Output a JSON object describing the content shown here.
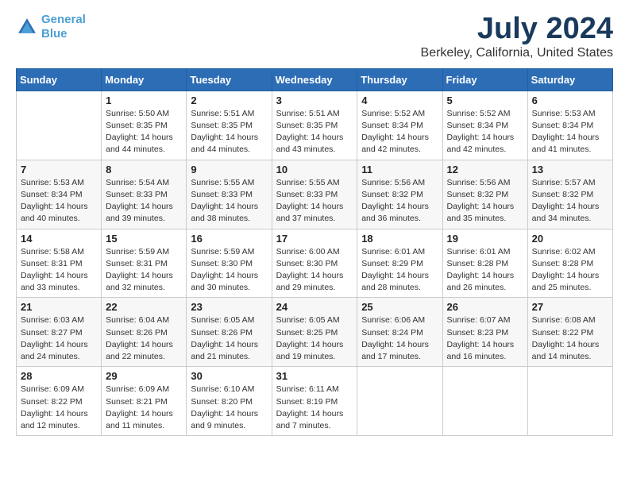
{
  "header": {
    "logo_line1": "General",
    "logo_line2": "Blue",
    "month": "July 2024",
    "location": "Berkeley, California, United States"
  },
  "weekdays": [
    "Sunday",
    "Monday",
    "Tuesday",
    "Wednesday",
    "Thursday",
    "Friday",
    "Saturday"
  ],
  "weeks": [
    [
      {
        "num": "",
        "info": ""
      },
      {
        "num": "1",
        "info": "Sunrise: 5:50 AM\nSunset: 8:35 PM\nDaylight: 14 hours\nand 44 minutes."
      },
      {
        "num": "2",
        "info": "Sunrise: 5:51 AM\nSunset: 8:35 PM\nDaylight: 14 hours\nand 44 minutes."
      },
      {
        "num": "3",
        "info": "Sunrise: 5:51 AM\nSunset: 8:35 PM\nDaylight: 14 hours\nand 43 minutes."
      },
      {
        "num": "4",
        "info": "Sunrise: 5:52 AM\nSunset: 8:34 PM\nDaylight: 14 hours\nand 42 minutes."
      },
      {
        "num": "5",
        "info": "Sunrise: 5:52 AM\nSunset: 8:34 PM\nDaylight: 14 hours\nand 42 minutes."
      },
      {
        "num": "6",
        "info": "Sunrise: 5:53 AM\nSunset: 8:34 PM\nDaylight: 14 hours\nand 41 minutes."
      }
    ],
    [
      {
        "num": "7",
        "info": "Sunrise: 5:53 AM\nSunset: 8:34 PM\nDaylight: 14 hours\nand 40 minutes."
      },
      {
        "num": "8",
        "info": "Sunrise: 5:54 AM\nSunset: 8:33 PM\nDaylight: 14 hours\nand 39 minutes."
      },
      {
        "num": "9",
        "info": "Sunrise: 5:55 AM\nSunset: 8:33 PM\nDaylight: 14 hours\nand 38 minutes."
      },
      {
        "num": "10",
        "info": "Sunrise: 5:55 AM\nSunset: 8:33 PM\nDaylight: 14 hours\nand 37 minutes."
      },
      {
        "num": "11",
        "info": "Sunrise: 5:56 AM\nSunset: 8:32 PM\nDaylight: 14 hours\nand 36 minutes."
      },
      {
        "num": "12",
        "info": "Sunrise: 5:56 AM\nSunset: 8:32 PM\nDaylight: 14 hours\nand 35 minutes."
      },
      {
        "num": "13",
        "info": "Sunrise: 5:57 AM\nSunset: 8:32 PM\nDaylight: 14 hours\nand 34 minutes."
      }
    ],
    [
      {
        "num": "14",
        "info": "Sunrise: 5:58 AM\nSunset: 8:31 PM\nDaylight: 14 hours\nand 33 minutes."
      },
      {
        "num": "15",
        "info": "Sunrise: 5:59 AM\nSunset: 8:31 PM\nDaylight: 14 hours\nand 32 minutes."
      },
      {
        "num": "16",
        "info": "Sunrise: 5:59 AM\nSunset: 8:30 PM\nDaylight: 14 hours\nand 30 minutes."
      },
      {
        "num": "17",
        "info": "Sunrise: 6:00 AM\nSunset: 8:30 PM\nDaylight: 14 hours\nand 29 minutes."
      },
      {
        "num": "18",
        "info": "Sunrise: 6:01 AM\nSunset: 8:29 PM\nDaylight: 14 hours\nand 28 minutes."
      },
      {
        "num": "19",
        "info": "Sunrise: 6:01 AM\nSunset: 8:28 PM\nDaylight: 14 hours\nand 26 minutes."
      },
      {
        "num": "20",
        "info": "Sunrise: 6:02 AM\nSunset: 8:28 PM\nDaylight: 14 hours\nand 25 minutes."
      }
    ],
    [
      {
        "num": "21",
        "info": "Sunrise: 6:03 AM\nSunset: 8:27 PM\nDaylight: 14 hours\nand 24 minutes."
      },
      {
        "num": "22",
        "info": "Sunrise: 6:04 AM\nSunset: 8:26 PM\nDaylight: 14 hours\nand 22 minutes."
      },
      {
        "num": "23",
        "info": "Sunrise: 6:05 AM\nSunset: 8:26 PM\nDaylight: 14 hours\nand 21 minutes."
      },
      {
        "num": "24",
        "info": "Sunrise: 6:05 AM\nSunset: 8:25 PM\nDaylight: 14 hours\nand 19 minutes."
      },
      {
        "num": "25",
        "info": "Sunrise: 6:06 AM\nSunset: 8:24 PM\nDaylight: 14 hours\nand 17 minutes."
      },
      {
        "num": "26",
        "info": "Sunrise: 6:07 AM\nSunset: 8:23 PM\nDaylight: 14 hours\nand 16 minutes."
      },
      {
        "num": "27",
        "info": "Sunrise: 6:08 AM\nSunset: 8:22 PM\nDaylight: 14 hours\nand 14 minutes."
      }
    ],
    [
      {
        "num": "28",
        "info": "Sunrise: 6:09 AM\nSunset: 8:22 PM\nDaylight: 14 hours\nand 12 minutes."
      },
      {
        "num": "29",
        "info": "Sunrise: 6:09 AM\nSunset: 8:21 PM\nDaylight: 14 hours\nand 11 minutes."
      },
      {
        "num": "30",
        "info": "Sunrise: 6:10 AM\nSunset: 8:20 PM\nDaylight: 14 hours\nand 9 minutes."
      },
      {
        "num": "31",
        "info": "Sunrise: 6:11 AM\nSunset: 8:19 PM\nDaylight: 14 hours\nand 7 minutes."
      },
      {
        "num": "",
        "info": ""
      },
      {
        "num": "",
        "info": ""
      },
      {
        "num": "",
        "info": ""
      }
    ]
  ]
}
